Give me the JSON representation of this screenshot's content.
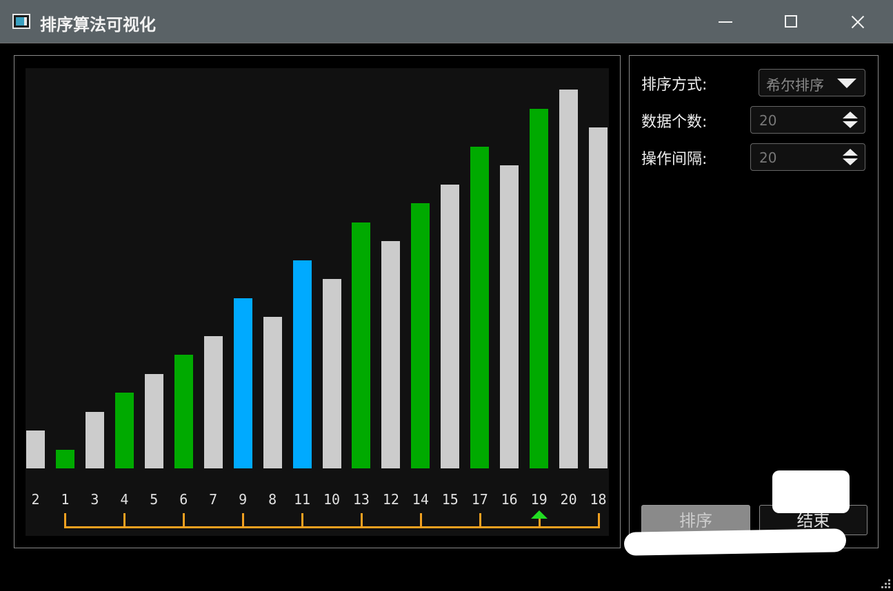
{
  "window": {
    "title": "排序算法可视化"
  },
  "colors": {
    "default": "#cccccc",
    "sorted_group": "#00aa00",
    "comparing": "#00aaff",
    "bracket": "#f0a020",
    "pointer": "#22dd22"
  },
  "chart_data": {
    "type": "bar",
    "categories": [
      "2",
      "1",
      "3",
      "4",
      "5",
      "6",
      "7",
      "9",
      "8",
      "11",
      "10",
      "13",
      "12",
      "14",
      "15",
      "17",
      "16",
      "19",
      "20",
      "18"
    ],
    "values": [
      2,
      1,
      3,
      4,
      5,
      6,
      7,
      9,
      8,
      11,
      10,
      13,
      12,
      14,
      15,
      17,
      16,
      19,
      20,
      18
    ],
    "bar_states": [
      "default",
      "sorted_group",
      "default",
      "sorted_group",
      "default",
      "sorted_group",
      "default",
      "comparing",
      "default",
      "comparing",
      "default",
      "sorted_group",
      "default",
      "sorted_group",
      "default",
      "sorted_group",
      "default",
      "sorted_group",
      "default",
      "default"
    ],
    "ylim": [
      0,
      20
    ],
    "grid": false,
    "bracket_positions": [
      1,
      3,
      5,
      7,
      9,
      11,
      13,
      15,
      17,
      19
    ],
    "pointer_index": 17
  },
  "controls": {
    "method_label": "排序方式:",
    "method_value": "希尔排序",
    "count_label": "数据个数:",
    "count_value": "20",
    "interval_label": "操作间隔:",
    "interval_value": "20",
    "sort_button": "排序",
    "stop_button": "结束"
  },
  "icons": {
    "app": "app-icon",
    "minimize": "minimize-icon",
    "maximize": "maximize-icon",
    "close": "close-icon",
    "dropdown": "chevron-down-icon",
    "spin_up": "spin-up-icon",
    "spin_down": "spin-down-icon"
  }
}
